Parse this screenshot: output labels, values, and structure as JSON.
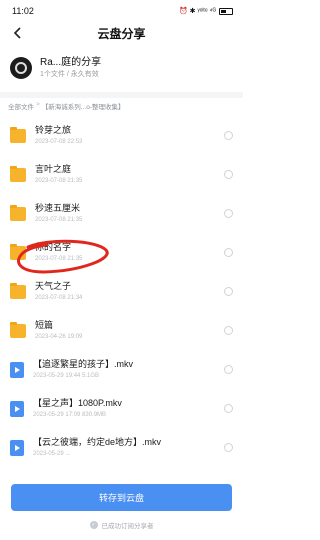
{
  "status_bar": {
    "time": "11:02",
    "indicators": "⏰ ✱ ᵞᵒˡᵗᵉ ⁴ᴳ",
    "battery_level": 0.4
  },
  "nav": {
    "back_icon": "chevron-left-icon",
    "title": "云盘分享"
  },
  "share": {
    "title": "Ra...庭的分享",
    "meta": "1个文件 / 永久有效"
  },
  "breadcrumb": [
    "全部文件",
    "【新海诚系列...o-整理收集】"
  ],
  "files": [
    {
      "type": "folder",
      "name": "铃芽之旅",
      "date": "2023-07-08 22:53"
    },
    {
      "type": "folder",
      "name": "言叶之庭",
      "date": "2023-07-08 21:35"
    },
    {
      "type": "folder",
      "name": "秒速五厘米",
      "date": "2023-07-08 21:35"
    },
    {
      "type": "folder",
      "name": "你的名字",
      "date": "2023-07-08 21:35"
    },
    {
      "type": "folder",
      "name": "天气之子",
      "date": "2023-07-08 21:34"
    },
    {
      "type": "folder",
      "name": "短篇",
      "date": "2023-04-26 19:09"
    },
    {
      "type": "video",
      "name": "【追逐繁星的孩子】.mkv",
      "date": "2023-05-29 19:44  5.1GB"
    },
    {
      "type": "video",
      "name": "【星之声】1080P.mkv",
      "date": "2023-05-29 17:09  830.9MB"
    },
    {
      "type": "video",
      "name": "【云之彼端，约定de地方】.mkv",
      "date": "2023-05-29 ..."
    }
  ],
  "bottom": {
    "save_label": "转存到云盘",
    "subscribe_note": "已成功订阅分享者"
  },
  "colors": {
    "accent": "#4a8ff2",
    "folder": "#f7b32b",
    "annotation": "#e0271c"
  }
}
